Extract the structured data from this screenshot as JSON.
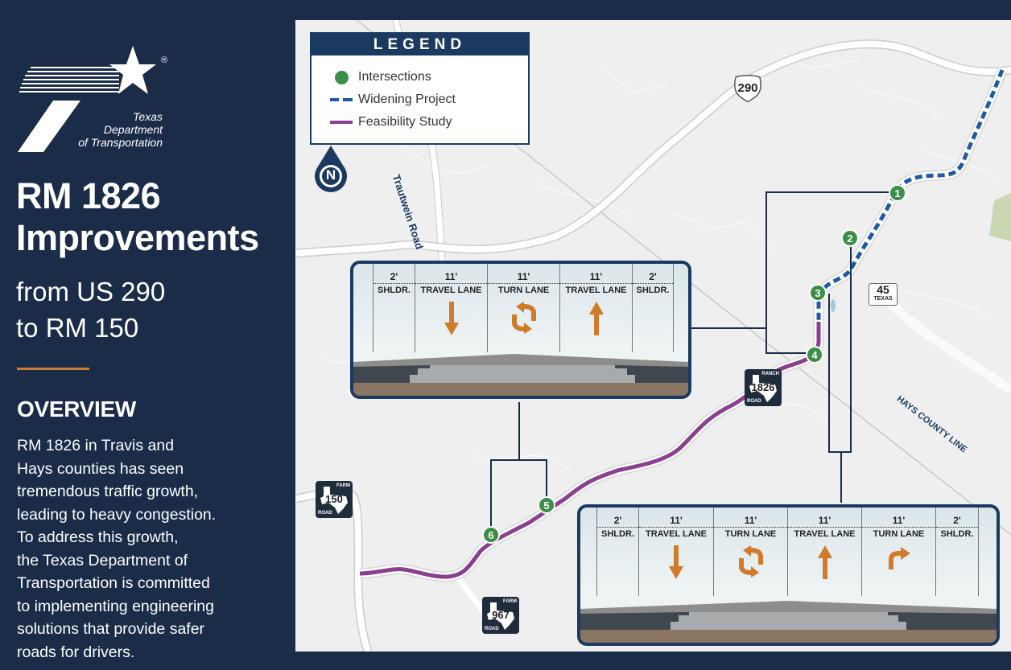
{
  "sidebar": {
    "logo": {
      "registered": "®",
      "lines": [
        "Texas",
        "Department",
        "of Transportation"
      ]
    },
    "title_lines": [
      "RM 1826",
      "Improvements"
    ],
    "subtitle_lines": [
      "from US 290",
      "to RM 150"
    ],
    "overview_heading": "OVERVIEW",
    "overview_lines": [
      "RM 1826 in Travis and",
      "Hays counties has seen",
      "tremendous traffic growth,",
      "leading to heavy congestion.",
      "To address this growth,",
      "the Texas Department of",
      "Transportation is committed",
      "to implementing engineering",
      "solutions that provide safer",
      "roads for drivers."
    ],
    "accent_color": "#c87d2e"
  },
  "legend": {
    "title": "LEGEND",
    "items": [
      {
        "label": "Intersections",
        "icon": "green-dot",
        "color": "#3b8f47"
      },
      {
        "label": "Widening Project",
        "icon": "blue-dashed-line",
        "color": "#1f5aa6"
      },
      {
        "label": "Feasibility Study",
        "icon": "purple-line",
        "color": "#8a3f8f"
      }
    ]
  },
  "map": {
    "north_label": "N",
    "road_labels": {
      "trautwein": "Trautwein Road",
      "county_line": "HAYS COUNTY LINE"
    },
    "shields": {
      "us290": "290",
      "tx45": {
        "number": "45",
        "state": "TEXAS"
      },
      "rm1826": {
        "number": "1826",
        "top": "RANCH",
        "bottom": "ROAD"
      },
      "fm150": {
        "number": "150",
        "top": "FARM",
        "bottom": "ROAD"
      },
      "fm967": {
        "number": "967",
        "top": "FARM",
        "bottom": "ROAD"
      }
    },
    "intersections": [
      "1",
      "2",
      "3",
      "4",
      "5",
      "6"
    ]
  },
  "cross_sections": {
    "three_lane": {
      "lanes": [
        {
          "width": "2'",
          "name": "SHLDR.",
          "arrow": "none"
        },
        {
          "width": "11'",
          "name": "TRAVEL LANE",
          "arrow": "down"
        },
        {
          "width": "11'",
          "name": "TURN LANE",
          "arrow": "two-way-turn"
        },
        {
          "width": "11'",
          "name": "TRAVEL LANE",
          "arrow": "up"
        },
        {
          "width": "2'",
          "name": "SHLDR.",
          "arrow": "none"
        }
      ]
    },
    "four_lane": {
      "lanes": [
        {
          "width": "2'",
          "name": "SHLDR.",
          "arrow": "none"
        },
        {
          "width": "11'",
          "name": "TRAVEL LANE",
          "arrow": "down"
        },
        {
          "width": "11'",
          "name": "TURN LANE",
          "arrow": "two-way-turn"
        },
        {
          "width": "11'",
          "name": "TRAVEL LANE",
          "arrow": "up"
        },
        {
          "width": "11'",
          "name": "TURN LANE",
          "arrow": "right-turn"
        },
        {
          "width": "2'",
          "name": "SHLDR.",
          "arrow": "none"
        }
      ]
    },
    "arrow_color": "#d07a2a"
  }
}
